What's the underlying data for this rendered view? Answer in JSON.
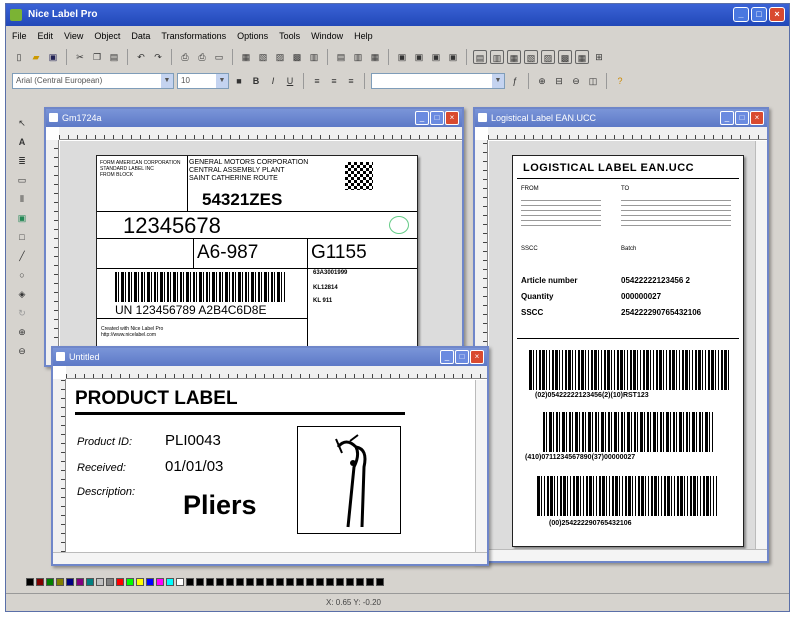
{
  "app": {
    "title": "Nice Label Pro"
  },
  "menu": [
    "File",
    "Edit",
    "View",
    "Object",
    "Data",
    "Transformations",
    "Options",
    "Tools",
    "Window",
    "Help"
  ],
  "toolbar": {
    "font_name": "Arial (Central European)",
    "font_size": "10",
    "bold": "B",
    "italic": "I",
    "underline": "U"
  },
  "windows": {
    "gm": {
      "title": "Gm1724a",
      "from_block": "FORM AMERICAN CORPORATION\nSTANDARD LABEL INC\nFROM BLOCK",
      "to_block": "GENERAL MOTORS CORPORATION\nCENTRAL ASSEMBLY PLANT\nSAINT CATHERINE ROUTE",
      "part_no": "54321ZES",
      "big_no": "12345678",
      "a6": "A6-987",
      "g1155": "G1155",
      "barcode_text": "UN 123456789 A2B4C6D8E",
      "side1": "63A3001999",
      "side2": "KL12814",
      "side3": "KL 911",
      "created": "Created with Nice Label Pro\nhttp://www.nicelabel.com"
    },
    "logistical": {
      "title": "Logistical Label EAN.UCC",
      "heading": "LOGISTICAL LABEL EAN.UCC",
      "from_label": "FROM",
      "to_label": "TO",
      "sscc_small": "SSCC",
      "batch_label": "Batch",
      "article_label": "Article number",
      "article_value": "05422222123456 2",
      "quantity_label": "Quantity",
      "quantity_value": "000000027",
      "sscc_label": "SSCC",
      "sscc_value": "254222290765432106",
      "bc1_text": "(02)05422222123456(2)(10)RST123",
      "bc2_text": "(410)0711234567890(37)00000027",
      "bc3_text": "(00)254222290765432106"
    },
    "untitled": {
      "title": "Untitled",
      "heading": "PRODUCT LABEL",
      "product_id_label": "Product ID:",
      "product_id_value": "PLI0043",
      "received_label": "Received:",
      "received_value": "01/01/03",
      "description_label": "Description:",
      "description_value": "Pliers",
      "image": "pliers-icon"
    }
  },
  "status": {
    "coords": "X: 0.65 Y: -0.20"
  },
  "palette": [
    "#000000",
    "#800000",
    "#008000",
    "#808000",
    "#000080",
    "#800080",
    "#008080",
    "#c0c0c0",
    "#808080",
    "#ff0000",
    "#00ff00",
    "#ffff00",
    "#0000ff",
    "#ff00ff",
    "#00ffff",
    "#ffffff"
  ]
}
